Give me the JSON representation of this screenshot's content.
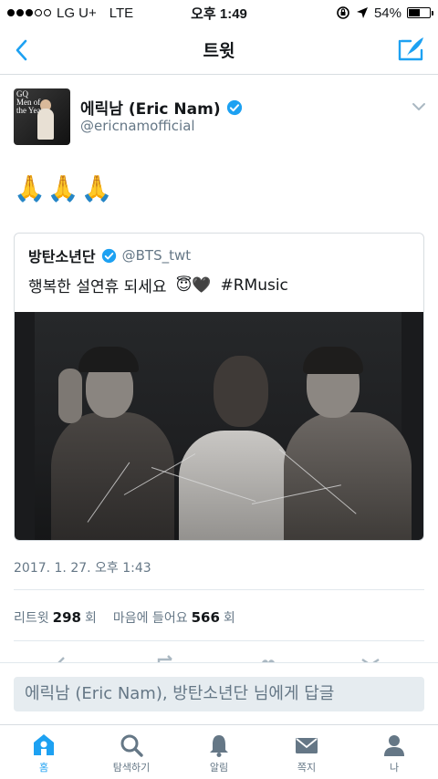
{
  "status_bar": {
    "carrier": "LG U+",
    "network": "LTE",
    "time": "오후 1:49",
    "battery_text": "54%",
    "battery_level": 0.54
  },
  "nav": {
    "title": "트윗",
    "accent_color": "#1da1f2"
  },
  "tweet": {
    "author_name": "에릭남 (Eric Nam)",
    "author_handle": "@ericnamofficial",
    "avatar_text": "GQ Men of the Year",
    "text": "🙏🙏🙏",
    "timestamp": "2017. 1. 27. 오후 1:43",
    "stats": {
      "retweets_label": "리트윗",
      "retweets_count": "298",
      "retweets_unit": "회",
      "likes_label": "마음에 들어요",
      "likes_count": "566",
      "likes_unit": "회"
    }
  },
  "quoted": {
    "author_name": "방탄소년단",
    "author_handle": "@BTS_twt",
    "text": "행복한 설연휴 되세요",
    "emoji": "😇🖤",
    "hashtag": "#RMusic"
  },
  "reply": {
    "placeholder": "에릭남 (Eric Nam), 방탄소년단 님에게 답글"
  },
  "tabs": [
    {
      "label": "홈",
      "icon": "home-icon",
      "active": true
    },
    {
      "label": "탐색하기",
      "icon": "search-icon",
      "active": false
    },
    {
      "label": "알림",
      "icon": "bell-icon",
      "active": false
    },
    {
      "label": "쪽지",
      "icon": "envelope-icon",
      "active": false
    },
    {
      "label": "나",
      "icon": "person-icon",
      "active": false
    }
  ]
}
